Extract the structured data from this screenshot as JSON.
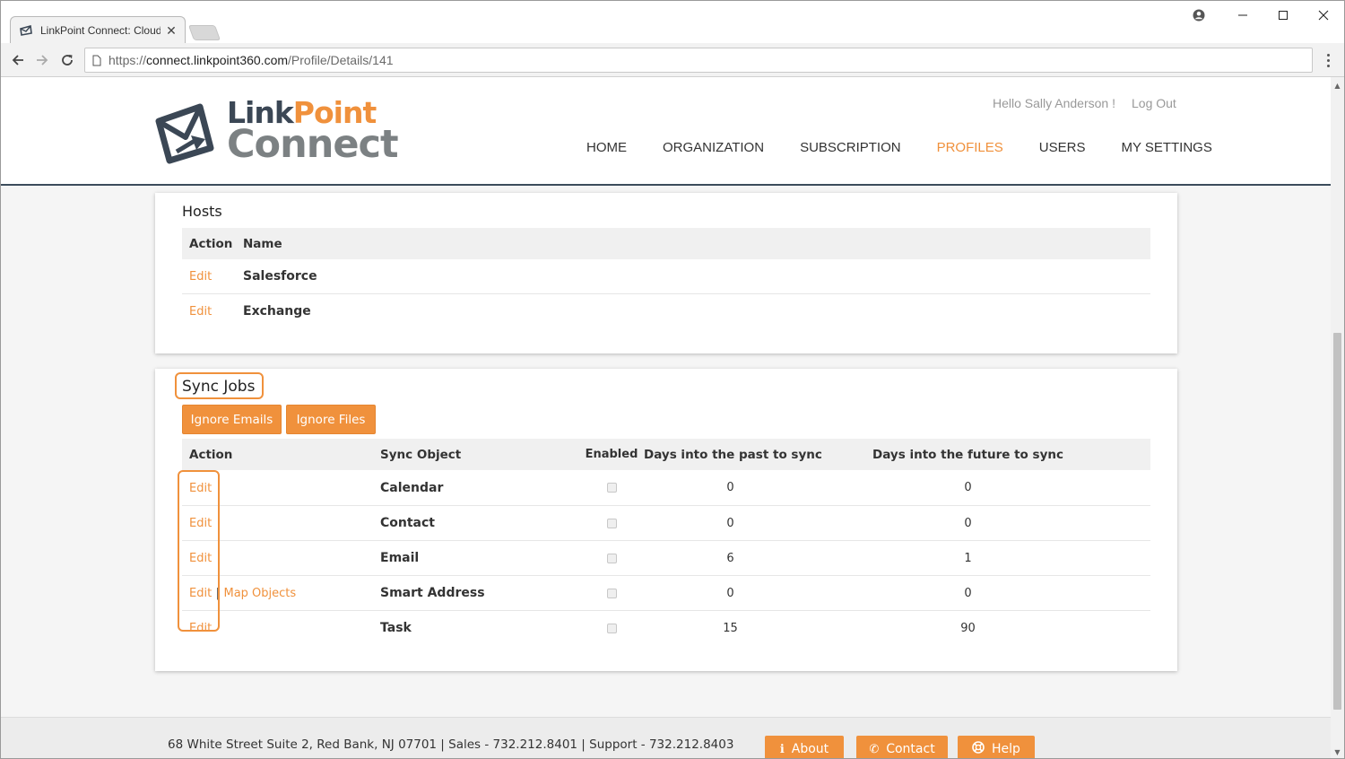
{
  "browser": {
    "tab_title": "LinkPoint Connect: Cloud",
    "tab_close": "✕",
    "url_proto": "https://",
    "url_host": "connect.linkpoint360.com",
    "url_path": "/Profile/Details/141"
  },
  "header": {
    "logo_link": "Link",
    "logo_point": "Point",
    "logo_connect": "Connect",
    "greeting": "Hello Sally Anderson !",
    "logout": "Log Out",
    "nav": {
      "home": "HOME",
      "organization": "ORGANIZATION",
      "subscription": "SUBSCRIPTION",
      "profiles": "PROFILES",
      "users": "USERS",
      "my_settings": "MY SETTINGS"
    }
  },
  "hosts": {
    "title": "Hosts",
    "col_action": "Action",
    "col_name": "Name",
    "rows": [
      {
        "action": "Edit",
        "name": "Salesforce"
      },
      {
        "action": "Edit",
        "name": "Exchange"
      }
    ]
  },
  "sync_jobs": {
    "title": "Sync Jobs",
    "ignore_emails": "Ignore Emails",
    "ignore_files": "Ignore Files",
    "col_action": "Action",
    "col_object": "Sync Object",
    "col_enabled": "Enabled",
    "col_past": "Days into the past to sync",
    "col_future": "Days into the future to sync",
    "rows": [
      {
        "edit": "Edit",
        "extra": "",
        "object": "Calendar",
        "enabled": false,
        "past": "0",
        "future": "0"
      },
      {
        "edit": "Edit",
        "extra": "",
        "object": "Contact",
        "enabled": false,
        "past": "0",
        "future": "0"
      },
      {
        "edit": "Edit",
        "extra": "",
        "object": "Email",
        "enabled": false,
        "past": "6",
        "future": "1"
      },
      {
        "edit": "Edit",
        "extra": "Map Objects",
        "object": "Smart Address",
        "enabled": false,
        "past": "0",
        "future": "0"
      },
      {
        "edit": "Edit",
        "extra": "",
        "object": "Task",
        "enabled": false,
        "past": "15",
        "future": "90"
      }
    ],
    "separator": "|"
  },
  "footer": {
    "address": "68 White Street Suite 2, Red Bank, NJ 07701 | Sales - 732.212.8401 | Support - 732.212.8403",
    "about": "About",
    "contact": "Contact",
    "help": "Help"
  },
  "icons": {
    "tab_favicon": "envelope-icon",
    "back": "arrow-left-icon",
    "forward": "arrow-right-icon",
    "reload": "reload-icon",
    "page": "page-icon",
    "menu": "more-vertical-icon",
    "profile": "user-circle-icon",
    "minimize": "minimize-icon",
    "maximize": "maximize-icon",
    "close": "close-icon"
  },
  "colors": {
    "accent": "#f0913c",
    "dark": "#3b4755",
    "gray_logo": "#7c8183"
  }
}
